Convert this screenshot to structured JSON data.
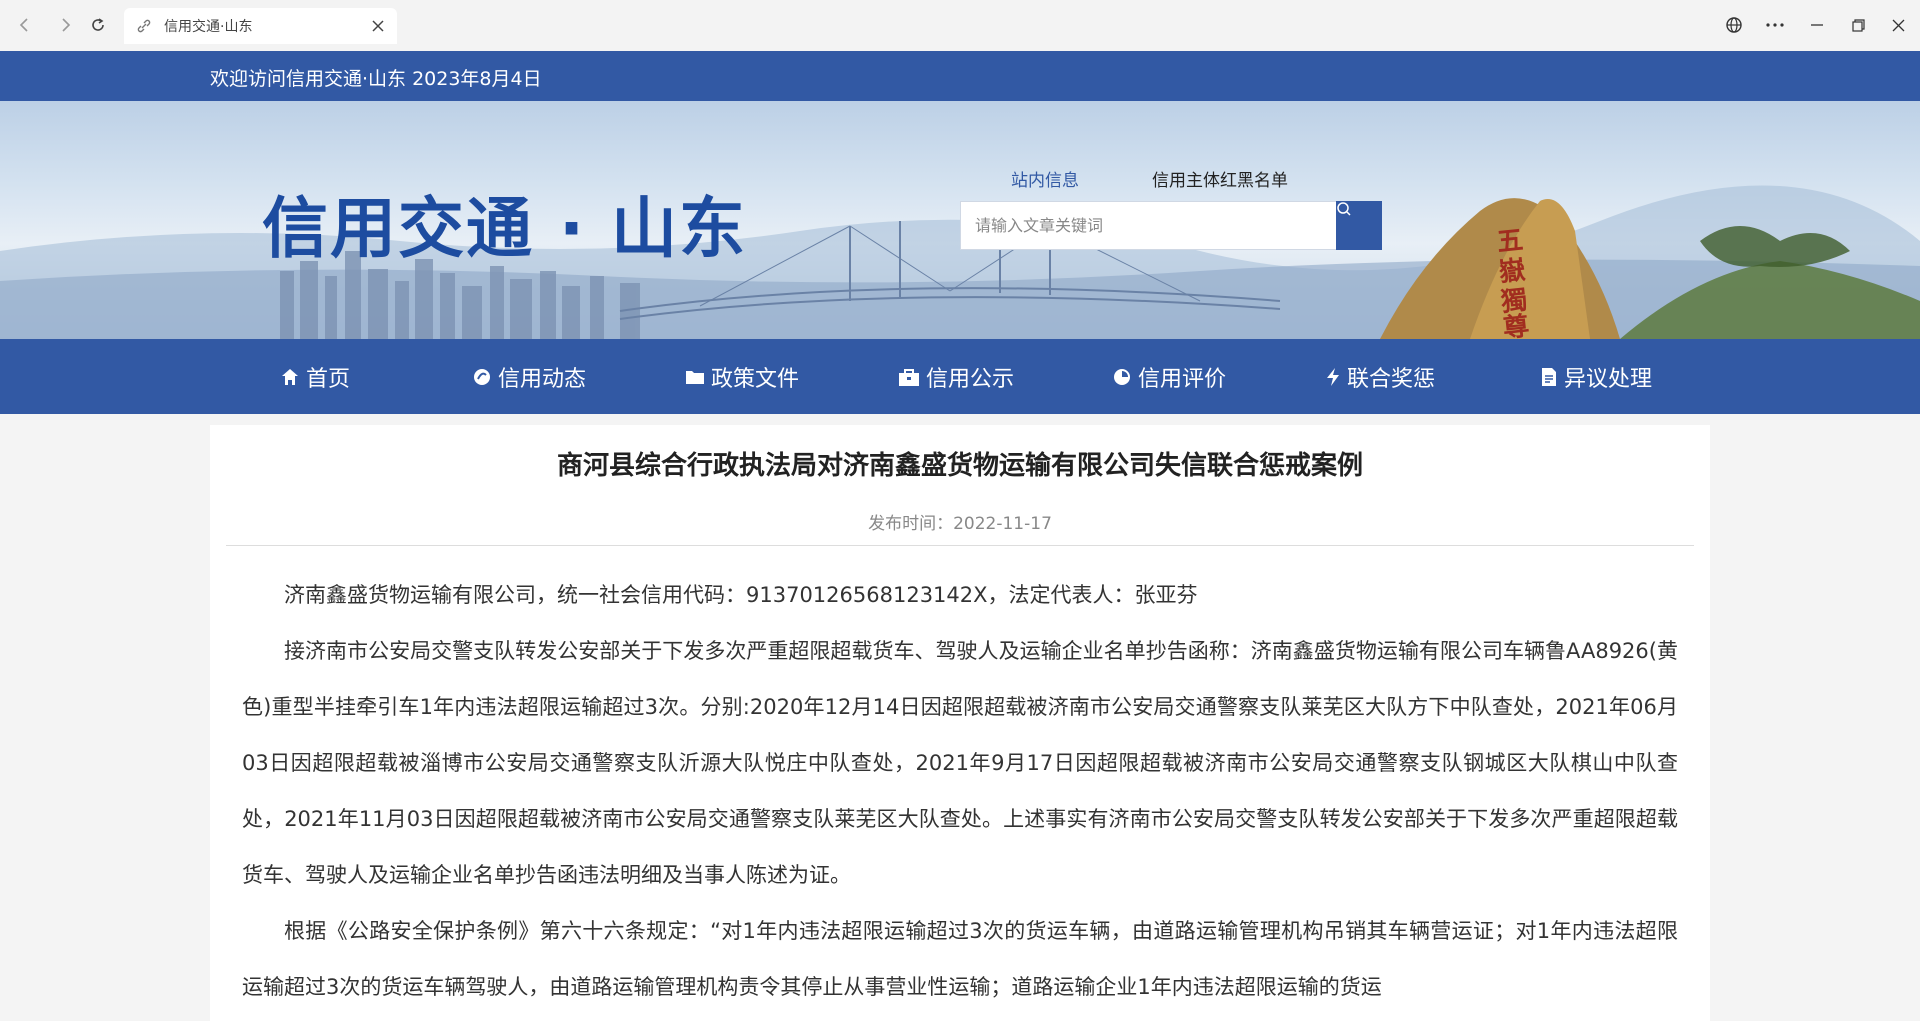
{
  "browser": {
    "tab_title": "信用交通·山东"
  },
  "header": {
    "welcome": "欢迎访问信用交通·山东 2023年8月4日",
    "logo": "信用交通 · 山东",
    "search": {
      "tabs": [
        "站内信息",
        "信用主体红黑名单"
      ],
      "active_tab": "站内信息",
      "placeholder": "请输入文章关键词",
      "value": ""
    }
  },
  "nav": {
    "items": [
      {
        "label": "首页",
        "icon": "home-icon"
      },
      {
        "label": "信用动态",
        "icon": "news-icon"
      },
      {
        "label": "政策文件",
        "icon": "folder-icon"
      },
      {
        "label": "信用公示",
        "icon": "briefcase-icon"
      },
      {
        "label": "信用评价",
        "icon": "rating-icon"
      },
      {
        "label": "联合奖惩",
        "icon": "lightning-icon"
      },
      {
        "label": "异议处理",
        "icon": "document-edit-icon"
      }
    ]
  },
  "article": {
    "title": "商河县综合行政执法局对济南鑫盛货物运输有限公司失信联合惩戒案例",
    "publish_label": "发布时间：",
    "publish_date": "2022-11-17",
    "paragraphs": [
      "济南鑫盛货物运输有限公司，统一社会信用代码：91370126568123142X，法定代表人：张亚芬",
      "接济南市公安局交警支队转发公安部关于下发多次严重超限超载货车、驾驶人及运输企业名单抄告函称：济南鑫盛货物运输有限公司车辆鲁AA8926(黄色)重型半挂牵引车1年内违法超限运输超过3次。分别:2020年12月14日因超限超载被济南市公安局交通警察支队莱芜区大队方下中队查处，2021年06月03日因超限超载被淄博市公安局交通警察支队沂源大队悦庄中队查处，2021年9月17日因超限超载被济南市公安局交通警察支队钢城区大队棋山中队查处，2021年11月03日因超限超载被济南市公安局交通警察支队莱芜区大队查处。上述事实有济南市公安局交警支队转发公安部关于下发多次严重超限超载货车、驾驶人及运输企业名单抄告函违法明细及当事人陈述为证。",
      "根据《公路安全保护条例》第六十六条规定：“对1年内违法超限运输超过3次的货运车辆，由道路运输管理机构吊销其车辆营运证；对1年内违法超限运输超过3次的货运车辆驾驶人，由道路运输管理机构责令其停止从事营业性运输；道路运输企业1年内违法超限运输的货运"
    ]
  }
}
